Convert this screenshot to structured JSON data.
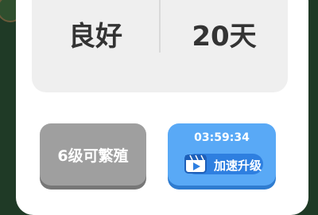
{
  "stats": {
    "condition": "良好",
    "days": "20天"
  },
  "actions": {
    "breed_label": "6级可繁殖",
    "timer": "03:59:34",
    "speed_up_label": "加速升级"
  },
  "icons": {
    "video": "video-play-icon"
  },
  "colors": {
    "background": "#1f3a26",
    "panel": "#ffffff",
    "card": "#efefef",
    "breed_button": "#9f9f9f",
    "speed_button": "#59a9f6",
    "speed_pill": "#2e7fe0"
  }
}
